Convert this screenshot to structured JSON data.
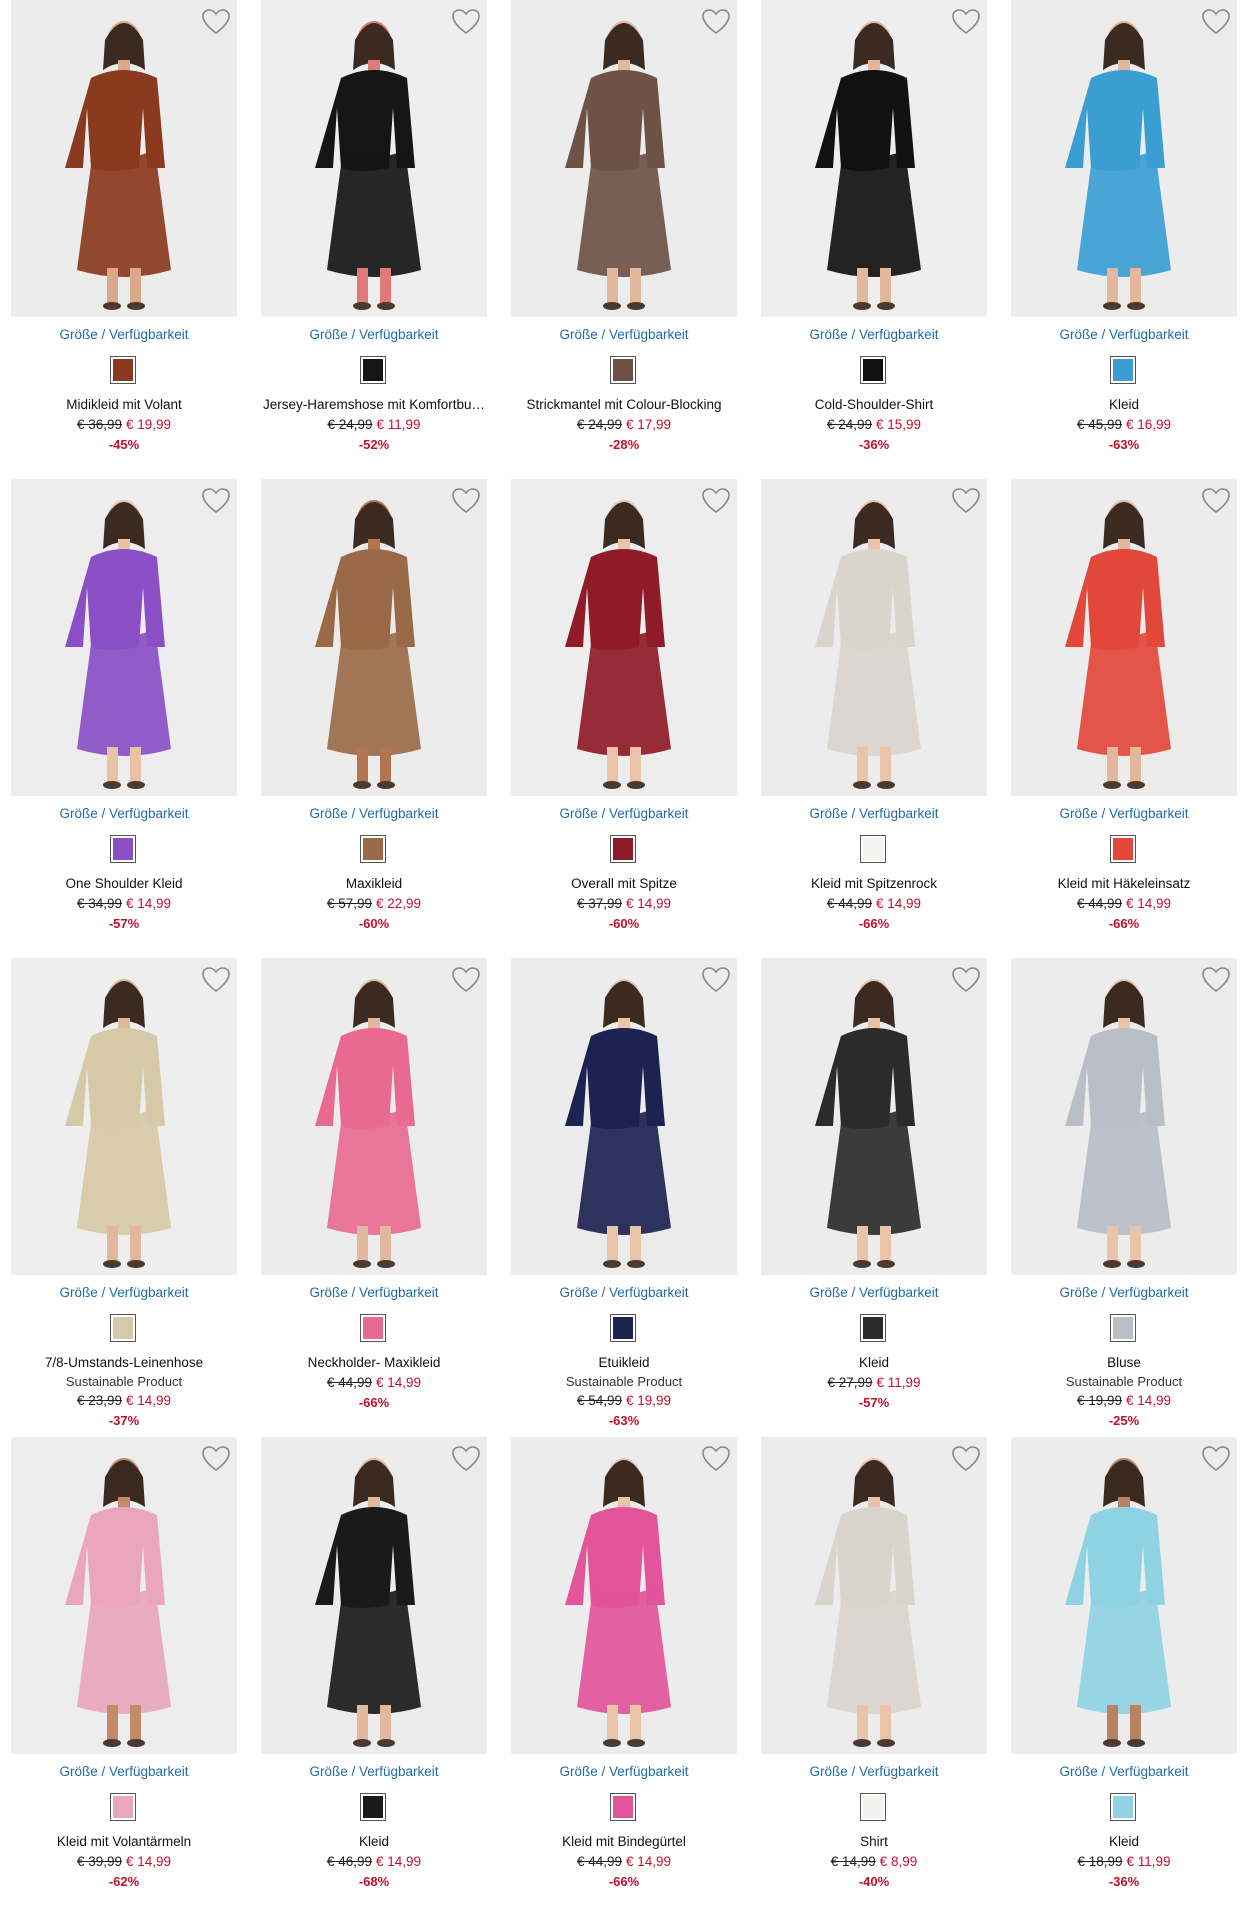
{
  "sizes_label": "Größe / Verfügbarkeit",
  "colors": {
    "link": "#1f6aa8",
    "sale": "#c0102e"
  },
  "products": [
    {
      "name": "Midikleid mit Volant",
      "sub": "",
      "old": "€ 36,99",
      "new": "€ 19,99",
      "discount": "-45%",
      "color": "#8a3a1e",
      "bg": "#ececec",
      "skin": "#d9a98a"
    },
    {
      "name": "Jersey-Haremshose mit Komfortbu…",
      "sub": "",
      "old": "€ 24,99",
      "new": "€ 11,99",
      "discount": "-52%",
      "color": "#151515",
      "bg": "#eeeeee",
      "skin": "#e07a78"
    },
    {
      "name": "Strickmantel mit Colour-Blocking",
      "sub": "",
      "old": "€ 24,99",
      "new": "€ 17,99",
      "discount": "-28%",
      "color": "#6e5246",
      "bg": "#ececec",
      "skin": "#e2b79b"
    },
    {
      "name": "Cold-Shoulder-Shirt",
      "sub": "",
      "old": "€ 24,99",
      "new": "€ 15,99",
      "discount": "-36%",
      "color": "#111111",
      "bg": "#eeeeee",
      "skin": "#e2b79b"
    },
    {
      "name": "Kleid",
      "sub": "",
      "old": "€ 45,99",
      "new": "€ 16,99",
      "discount": "-63%",
      "color": "#3b9ed2",
      "bg": "#ececec",
      "skin": "#e2b79b"
    },
    {
      "name": "One Shoulder Kleid",
      "sub": "",
      "old": "€ 34,99",
      "new": "€ 14,99",
      "discount": "-57%",
      "color": "#8a4fc4",
      "bg": "#ededed",
      "skin": "#e9c2a6"
    },
    {
      "name": "Maxikleid",
      "sub": "",
      "old": "€ 57,99",
      "new": "€ 22,99",
      "discount": "-60%",
      "color": "#9a6a48",
      "bg": "#ececec",
      "skin": "#b27552"
    },
    {
      "name": "Overall mit Spitze",
      "sub": "",
      "old": "€ 37,99",
      "new": "€ 14,99",
      "discount": "-60%",
      "color": "#8e1b27",
      "bg": "#ededed",
      "skin": "#ebc3a8"
    },
    {
      "name": "Kleid mit Spitzenrock",
      "sub": "",
      "old": "€ 44,99",
      "new": "€ 14,99",
      "discount": "-66%",
      "color": "#f6f4f0",
      "bg": "#ececec",
      "skin": "#ebc3a8"
    },
    {
      "name": "Kleid mit Häkeleinsatz",
      "sub": "",
      "old": "€ 44,99",
      "new": "€ 14,99",
      "discount": "-66%",
      "color": "#e2483a",
      "bg": "#ececec",
      "skin": "#e2b79b"
    },
    {
      "name": "7/8-Umstands-Leinenhose",
      "sub": "Sustainable Product",
      "old": "€ 23,99",
      "new": "€ 14,99",
      "discount": "-37%",
      "color": "#d6c9a7",
      "bg": "#eeeeee",
      "skin": "#e2b79b"
    },
    {
      "name": "Neckholder- Maxikleid",
      "sub": "",
      "old": "€ 44,99",
      "new": "€ 14,99",
      "discount": "-66%",
      "color": "#e86a92",
      "bg": "#ececec",
      "skin": "#e2b79b"
    },
    {
      "name": "Etuikleid",
      "sub": "Sustainable Product",
      "old": "€ 54,99",
      "new": "€ 19,99",
      "discount": "-63%",
      "color": "#1c2350",
      "bg": "#ececec",
      "skin": "#ebc3a8"
    },
    {
      "name": "Kleid",
      "sub": "",
      "old": "€ 27,99",
      "new": "€ 11,99",
      "discount": "-57%",
      "color": "#2b2b2b",
      "bg": "#ececec",
      "skin": "#ebc3a8"
    },
    {
      "name": "Bluse",
      "sub": "Sustainable Product",
      "old": "€ 19,99",
      "new": "€ 14,99",
      "discount": "-25%",
      "color": "#b9bec7",
      "bg": "#ececec",
      "skin": "#ebc3a8"
    },
    {
      "name": "Kleid mit Volantärmeln",
      "sub": "",
      "old": "€ 39,99",
      "new": "€ 14,99",
      "discount": "-62%",
      "color": "#e9a6bd",
      "bg": "#ededed",
      "skin": "#c48a66"
    },
    {
      "name": "Kleid",
      "sub": "",
      "old": "€ 46,99",
      "new": "€ 14,99",
      "discount": "-68%",
      "color": "#1a1a1a",
      "bg": "#ececec",
      "skin": "#e2b79b"
    },
    {
      "name": "Kleid mit Bindegürtel",
      "sub": "",
      "old": "€ 44,99",
      "new": "€ 14,99",
      "discount": "-66%",
      "color": "#e2559a",
      "bg": "#ececec",
      "skin": "#ebc3a8"
    },
    {
      "name": "Shirt",
      "sub": "",
      "old": "€ 14,99",
      "new": "€ 8,99",
      "discount": "-40%",
      "color": "#f3f1ee",
      "bg": "#ececec",
      "skin": "#ebc3a8"
    },
    {
      "name": "Kleid",
      "sub": "",
      "old": "€ 18,99",
      "new": "€ 11,99",
      "discount": "-36%",
      "color": "#8fd3e3",
      "bg": "#ececec",
      "skin": "#b88362"
    }
  ]
}
